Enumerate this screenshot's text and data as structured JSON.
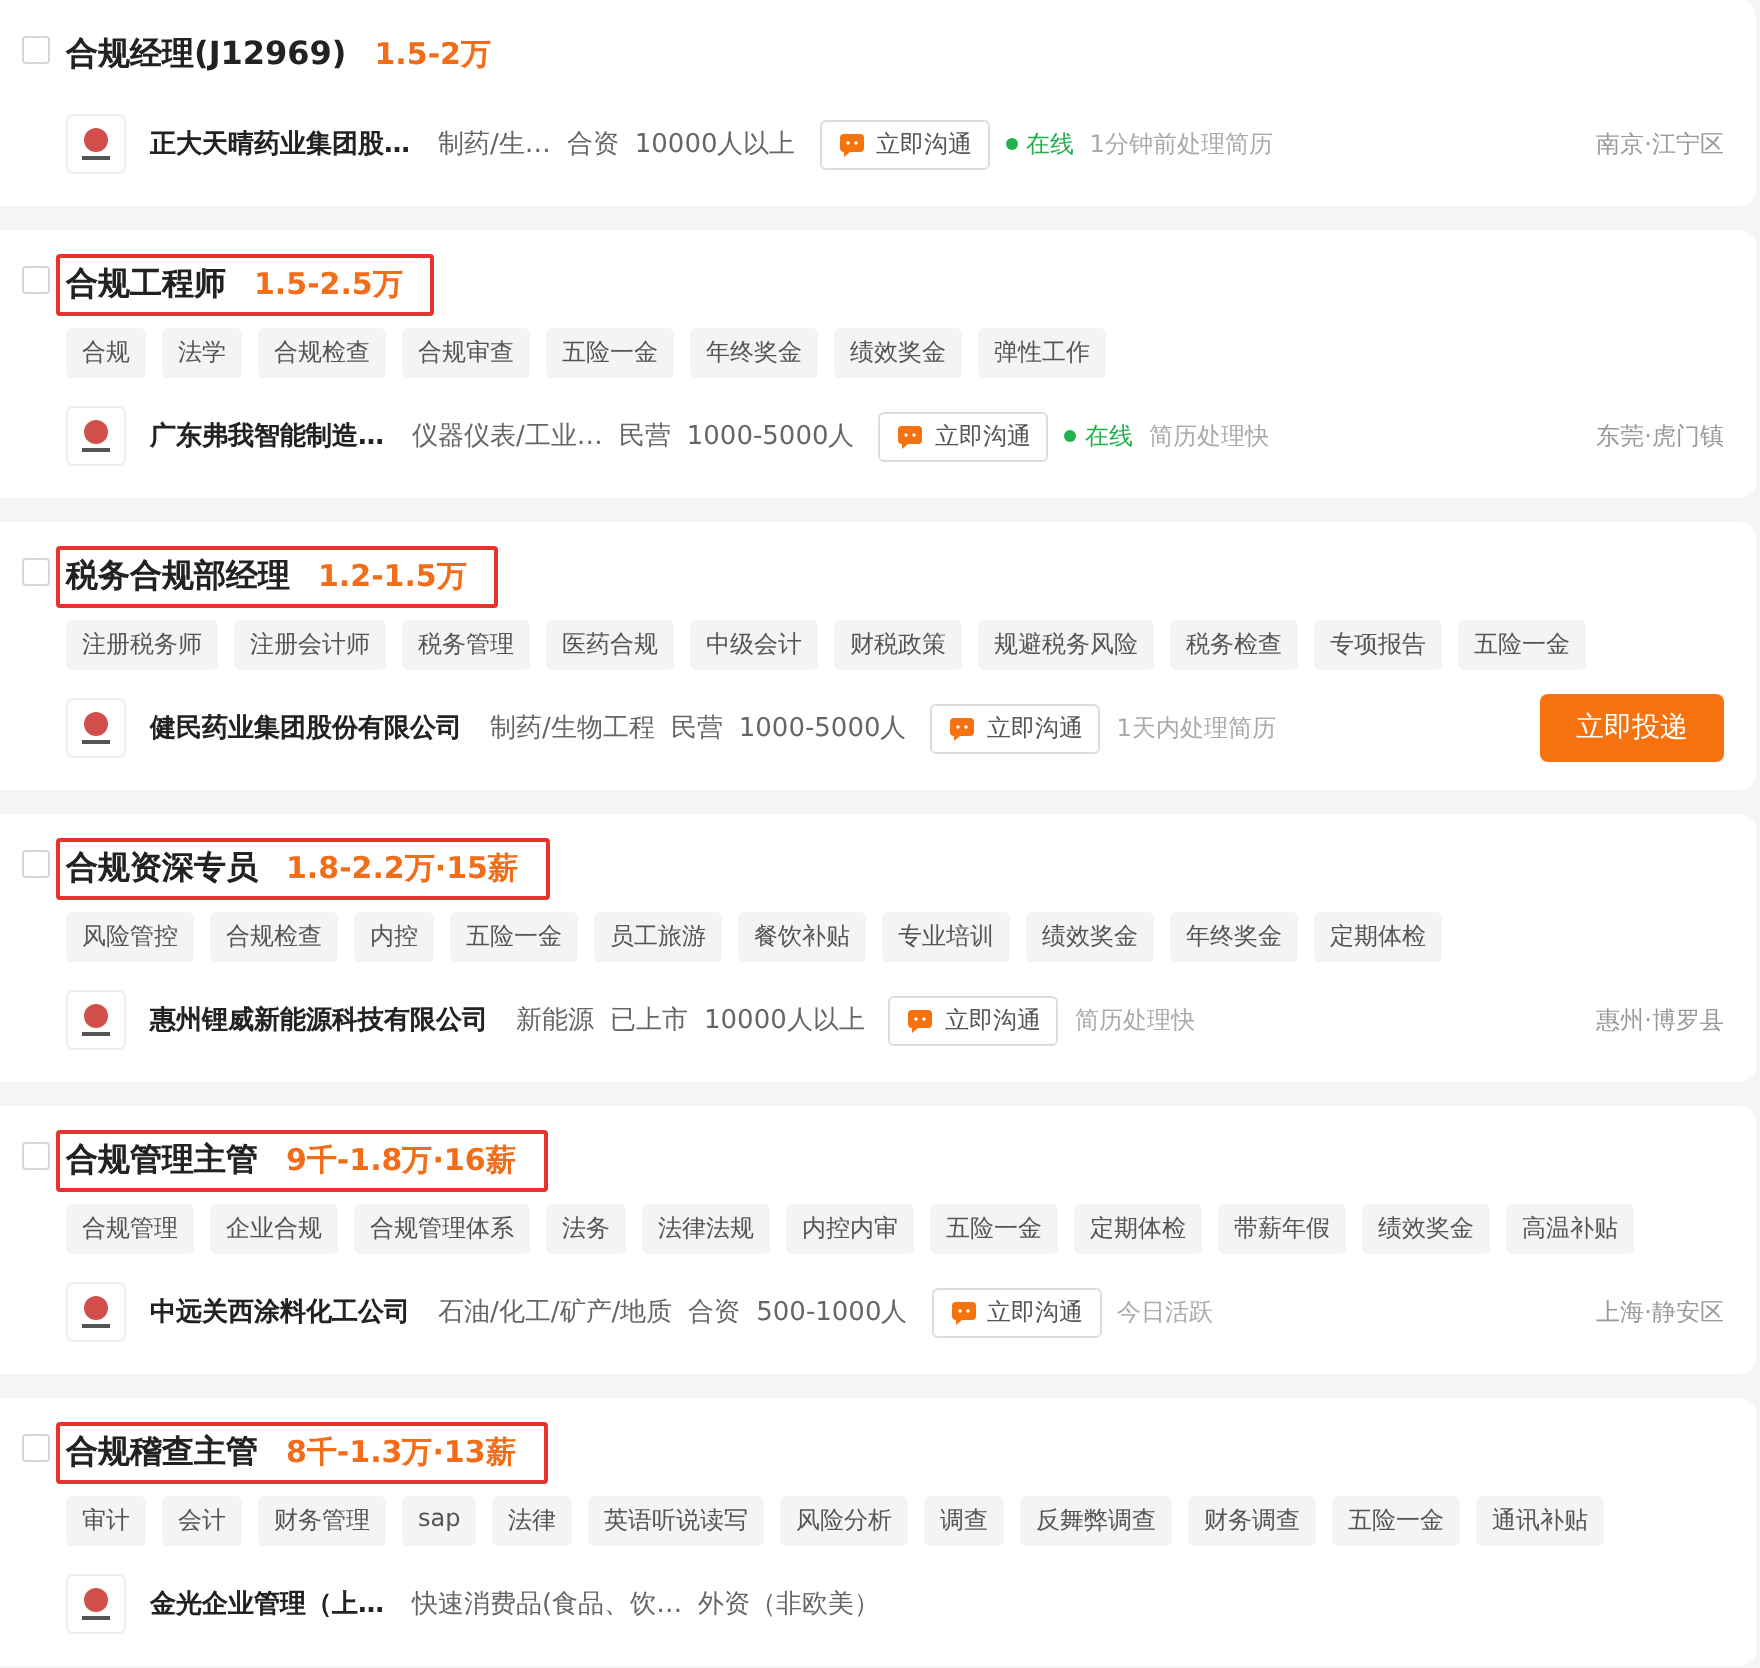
{
  "jobs": [
    {
      "title": "合规经理(J12969)",
      "salary": "1.5-2万",
      "checked": false,
      "highlighted": false,
      "company": {
        "name": "正大天晴药业集团股…",
        "industry": "制药/生…",
        "ownership": "合资",
        "size": "10000人以上"
      },
      "chat_button": "立即沟通",
      "status": "在线",
      "activity": "1分钟前处理简历",
      "location": "南京·江宁区"
    },
    {
      "title": "合规工程师",
      "salary": "1.5-2.5万",
      "checked": false,
      "highlighted": true,
      "tags": [
        "合规",
        "法学",
        "合规检查",
        "合规审查",
        "五险一金",
        "年终奖金",
        "绩效奖金",
        "弹性工作"
      ],
      "company": {
        "name": "广东弗我智能制造…",
        "industry": "仪器仪表/工业…",
        "ownership": "民营",
        "size": "1000-5000人"
      },
      "chat_button": "立即沟通",
      "status": "在线",
      "activity": "简历处理快",
      "location": "东莞·虎门镇"
    },
    {
      "title": "税务合规部经理",
      "salary": "1.2-1.5万",
      "checked": false,
      "highlighted": true,
      "tags": [
        "注册税务师",
        "注册会计师",
        "税务管理",
        "医药合规",
        "中级会计",
        "财税政策",
        "规避税务风险",
        "税务检查",
        "专项报告",
        "五险一金"
      ],
      "company": {
        "name": "健民药业集团股份有限公司",
        "industry": "制药/生物工程",
        "ownership": "民营",
        "size": "1000-5000人"
      },
      "chat_button": "立即沟通",
      "activity": "1天内处理简历",
      "apply_button": "立即投递"
    },
    {
      "title": "合规资深专员",
      "salary": "1.8-2.2万·15薪",
      "checked": false,
      "highlighted": true,
      "tags": [
        "风险管控",
        "合规检查",
        "内控",
        "五险一金",
        "员工旅游",
        "餐饮补贴",
        "专业培训",
        "绩效奖金",
        "年终奖金",
        "定期体检"
      ],
      "company": {
        "name": "惠州锂威新能源科技有限公司",
        "industry": "新能源",
        "ownership": "已上市",
        "size": "10000人以上"
      },
      "chat_button": "立即沟通",
      "activity": "简历处理快",
      "location": "惠州·博罗县"
    },
    {
      "title": "合规管理主管",
      "salary": "9千-1.8万·16薪",
      "checked": false,
      "highlighted": true,
      "tags": [
        "合规管理",
        "企业合规",
        "合规管理体系",
        "法务",
        "法律法规",
        "内控内审",
        "五险一金",
        "定期体检",
        "带薪年假",
        "绩效奖金",
        "高温补贴"
      ],
      "company": {
        "name": "中远关西涂料化工公司",
        "industry": "石油/化工/矿产/地质",
        "ownership": "合资",
        "size": "500-1000人"
      },
      "chat_button": "立即沟通",
      "activity": "今日活跃",
      "location": "上海·静安区"
    },
    {
      "title": "合规稽查主管",
      "salary": "8千-1.3万·13薪",
      "checked": false,
      "highlighted": true,
      "tags": [
        "审计",
        "会计",
        "财务管理",
        "sap",
        "法律",
        "英语听说读写",
        "风险分析",
        "调查",
        "反舞弊调查",
        "财务调查",
        "五险一金",
        "通讯补贴"
      ],
      "company": {
        "name": "金光企业管理（上…",
        "industry": "快速消费品(食品、饮…",
        "ownership": "外资（非欧美）"
      }
    }
  ]
}
